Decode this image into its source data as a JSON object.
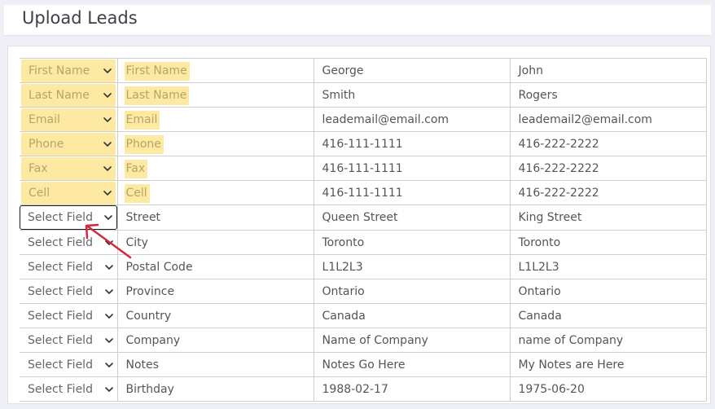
{
  "header": {
    "title": "Upload Leads"
  },
  "colors": {
    "highlight": "#fde9a2",
    "highlight_text": "#b8a467",
    "arrow": "#d6253f"
  },
  "rows": [
    {
      "select": "First Name",
      "label": "First Name",
      "v1": "George",
      "v2": "John",
      "mapped": true
    },
    {
      "select": "Last Name",
      "label": "Last Name",
      "v1": "Smith",
      "v2": "Rogers",
      "mapped": true
    },
    {
      "select": "Email",
      "label": "Email",
      "v1": "leademail@email.com",
      "v2": "leademail2@email.com",
      "mapped": true
    },
    {
      "select": "Phone",
      "label": "Phone",
      "v1": "416-111-1111",
      "v2": "416-222-2222",
      "mapped": true
    },
    {
      "select": "Fax",
      "label": "Fax",
      "v1": "416-111-1111",
      "v2": "416-222-2222",
      "mapped": true
    },
    {
      "select": "Cell",
      "label": "Cell",
      "v1": "416-111-1111",
      "v2": "416-222-2222",
      "mapped": true
    },
    {
      "select": "Select Field",
      "label": "Street",
      "v1": "Queen Street",
      "v2": "King Street",
      "mapped": false,
      "focused": true
    },
    {
      "select": "Select Field",
      "label": "City",
      "v1": "Toronto",
      "v2": "Toronto",
      "mapped": false
    },
    {
      "select": "Select Field",
      "label": "Postal Code",
      "v1": "L1L2L3",
      "v2": "L1L2L3",
      "mapped": false
    },
    {
      "select": "Select Field",
      "label": "Province",
      "v1": "Ontario",
      "v2": "Ontario",
      "mapped": false
    },
    {
      "select": "Select Field",
      "label": "Country",
      "v1": "Canada",
      "v2": "Canada",
      "mapped": false
    },
    {
      "select": "Select Field",
      "label": "Company",
      "v1": "Name of Company",
      "v2": "name of Company",
      "mapped": false
    },
    {
      "select": "Select Field",
      "label": "Notes",
      "v1": "Notes Go Here",
      "v2": "My Notes are Here",
      "mapped": false
    },
    {
      "select": "Select Field",
      "label": "Birthday",
      "v1": "1988-02-17",
      "v2": "1975-06-20",
      "mapped": false
    }
  ]
}
